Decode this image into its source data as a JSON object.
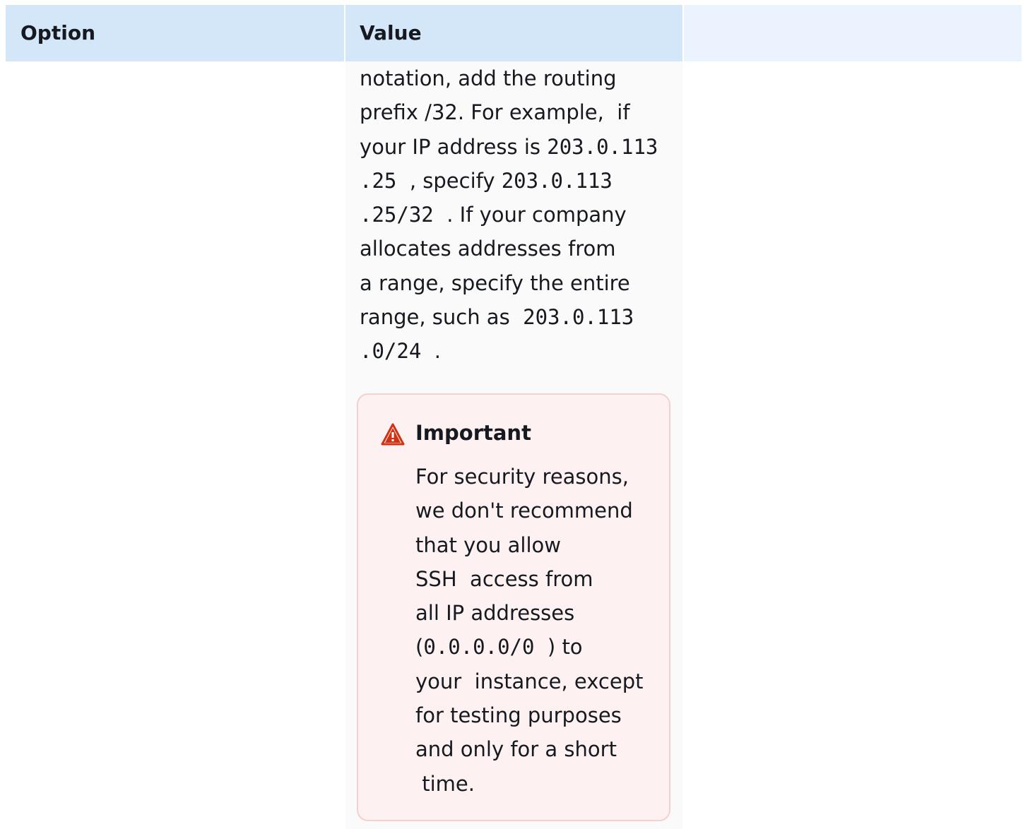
{
  "table": {
    "headers": {
      "option": "Option",
      "value": "Value"
    },
    "value_lines": [
      [
        {
          "t": "notation, add the routing"
        }
      ],
      [
        {
          "t": "prefix /32. For example,  if"
        }
      ],
      [
        {
          "t": "your IP address is "
        },
        {
          "c": "203.0.113"
        }
      ],
      [
        {
          "c": ".25"
        },
        {
          "t": "  , specify "
        },
        {
          "c": "203.0.113"
        }
      ],
      [
        {
          "c": ".25/32"
        },
        {
          "t": "  . If your company"
        }
      ],
      [
        {
          "t": "allocates addresses from"
        }
      ],
      [
        {
          "t": "a range, specify the entire"
        }
      ],
      [
        {
          "t": "range, such as  "
        },
        {
          "c": "203.0.113"
        }
      ],
      [
        {
          "c": ".0/24"
        },
        {
          "t": "  ."
        }
      ]
    ]
  },
  "alert": {
    "icon": "warning-triangle-icon",
    "color": "#d13212",
    "title": "Important",
    "lines": [
      [
        {
          "t": "For security reasons,"
        }
      ],
      [
        {
          "t": "we don't recommend"
        }
      ],
      [
        {
          "t": "that you allow"
        }
      ],
      [
        {
          "t": "SSH  access from"
        }
      ],
      [
        {
          "t": "all IP addresses"
        }
      ],
      [
        {
          "t": "("
        },
        {
          "c": "0.0.0.0/0"
        },
        {
          "t": "  ) to"
        }
      ],
      [
        {
          "t": "your  instance, except"
        }
      ],
      [
        {
          "t": "for testing purposes"
        }
      ],
      [
        {
          "t": "and only for a short"
        }
      ],
      [
        {
          "t": " time."
        }
      ]
    ]
  }
}
